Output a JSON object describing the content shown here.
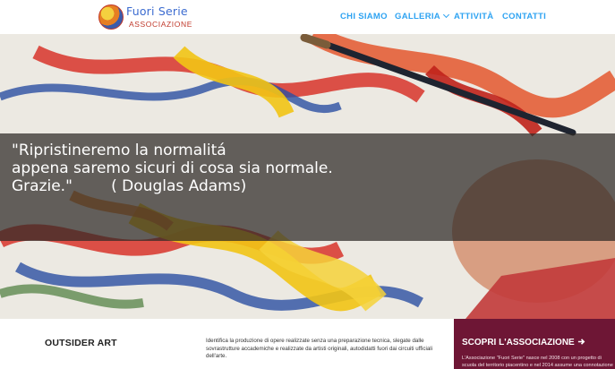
{
  "header": {
    "logo": {
      "title": "Fuori Serie",
      "subtitle": "ASSOCIAZIONE"
    },
    "nav": {
      "items": [
        {
          "label": "CHI SIAMO"
        },
        {
          "label": "GALLERIA"
        },
        {
          "label": "ATTIVITÀ"
        },
        {
          "label": "CONTATTI"
        }
      ],
      "color": "#2ea3f2"
    }
  },
  "hero": {
    "quote_line1": "\"Ripristineremo la normalitá",
    "quote_line2": "appena saremo sicuri di cosa sia normale.",
    "quote_line3": "Grazie.\"        ( Douglas Adams)"
  },
  "section": {
    "title": "OUTSIDER ART",
    "description": "Identifica la produzione di opere realizzate senza una preparazione tecnica, slegate dalle sovrastrutture accademiche e realizzate da artisti originali, autodidatti fuori dai circuiti ufficiali dell'arte."
  },
  "cta": {
    "title": "SCOPRI L'ASSOCIAZIONE",
    "arrow_icon": "arrow-right-icon",
    "text_line1": "L'Associazione \"Fuori Serie\" nasce nel 2008 con un progetto di",
    "text_line2": "scuola del territorio piacentino e nel 2014 assume una connotazione",
    "background": "#6e1635"
  }
}
